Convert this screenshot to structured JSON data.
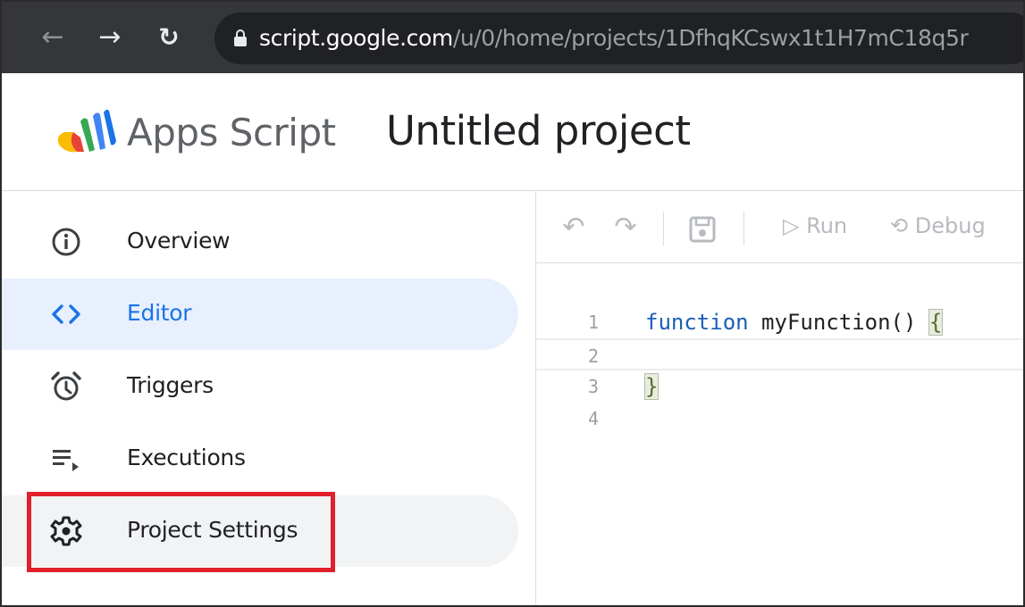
{
  "browser": {
    "url_host": "script.google.com",
    "url_path": "/u/0/home/projects/1DfhqKCswx1t1H7mC18q5r"
  },
  "header": {
    "app_name": "Apps Script",
    "project_title": "Untitled project"
  },
  "sidebar": {
    "items": [
      {
        "label": "Overview",
        "icon": "info-icon"
      },
      {
        "label": "Editor",
        "icon": "code-icon",
        "active": true
      },
      {
        "label": "Triggers",
        "icon": "alarm-clock-icon"
      },
      {
        "label": "Executions",
        "icon": "list-play-icon"
      },
      {
        "label": "Project Settings",
        "icon": "gear-icon",
        "highlighted": true
      }
    ]
  },
  "toolbar": {
    "run_label": "Run",
    "debug_label": "Debug"
  },
  "code": {
    "line_numbers": [
      "1",
      "2",
      "3",
      "4"
    ],
    "keyword": "function",
    "function_sig": " myFunction() ",
    "open_brace": "{",
    "close_brace": "}"
  },
  "colors": {
    "accent": "#1a73e8",
    "active_bg": "#e8f0fe",
    "highlight_border": "#e0202a",
    "browser_bar": "#35363a"
  }
}
